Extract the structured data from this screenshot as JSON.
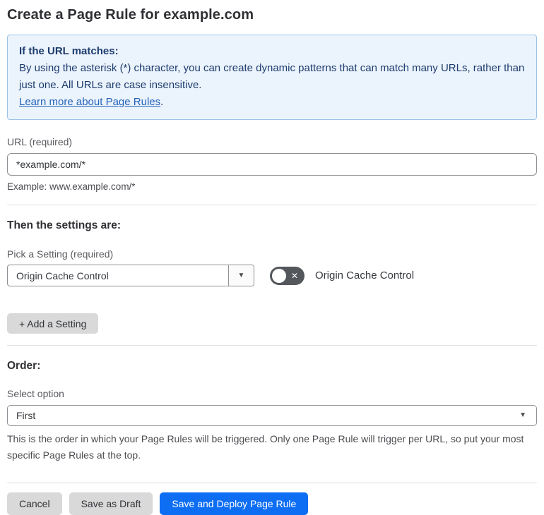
{
  "page": {
    "title": "Create a Page Rule for example.com"
  },
  "info_box": {
    "heading": "If the URL matches:",
    "body": "By using the asterisk (*) character, you can create dynamic patterns that can match many URLs, rather than just one. All URLs are case insensitive.",
    "link_label": "Learn more about Page Rules",
    "link_suffix": "."
  },
  "url_field": {
    "label": "URL (required)",
    "value": "*example.com/*",
    "helper": "Example: www.example.com/*"
  },
  "settings_section": {
    "heading": "Then the settings are:",
    "picker_label": "Pick a Setting (required)",
    "picker_value": "Origin Cache Control",
    "picker_arrow": "▼",
    "toggle_state": "off",
    "toggle_off_glyph": "✕",
    "toggle_label": "Origin Cache Control",
    "add_button_label": "+ Add a Setting"
  },
  "order_section": {
    "heading": "Order:",
    "select_label": "Select option",
    "select_value": "First",
    "select_arrow": "▼",
    "helper": "This is the order in which your Page Rules will be triggered. Only one Page Rule will trigger per URL, so put your most specific Page Rules at the top."
  },
  "footer": {
    "cancel_label": "Cancel",
    "save_draft_label": "Save as Draft",
    "save_deploy_label": "Save and Deploy Page Rule"
  },
  "colors": {
    "accent_blue": "#0d6ef4",
    "link_blue": "#2462b9",
    "info_background": "#ebf3fc",
    "info_border": "#9cc3ea",
    "info_text": "#1d3c6e",
    "toggle_off_background": "#54575b",
    "button_gray": "#d9d9d9",
    "divider_gray": "#e0e0e0"
  }
}
